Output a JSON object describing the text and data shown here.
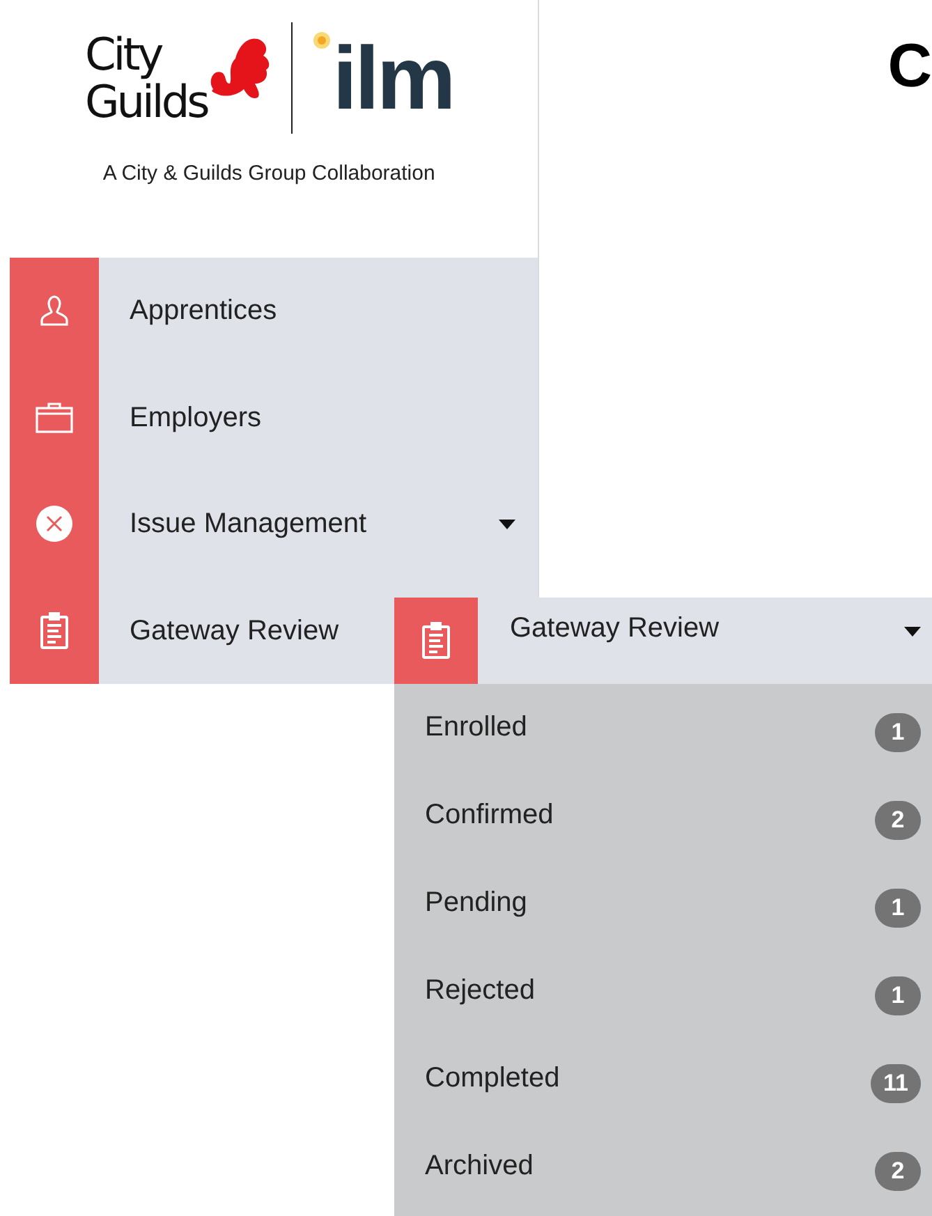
{
  "logo": {
    "wordmark": [
      "City",
      "Guilds"
    ],
    "brand": "ilm",
    "tagline": "A City & Guilds Group Collaboration"
  },
  "heading": "C",
  "sidebar": {
    "items": [
      {
        "label": "Apprentices",
        "kind": "person",
        "has_submenu": false
      },
      {
        "label": "Employers",
        "kind": "briefcase",
        "has_submenu": false
      },
      {
        "label": "Issue Management",
        "kind": "cross",
        "has_submenu": true
      },
      {
        "label": "Gateway Review",
        "kind": "clipboard",
        "has_submenu": false
      }
    ]
  },
  "submenu": {
    "title": "Gateway Review",
    "kind": "clipboard",
    "expanded": true,
    "items": [
      {
        "label": "Enrolled",
        "count": "1"
      },
      {
        "label": "Confirmed",
        "count": "2"
      },
      {
        "label": "Pending",
        "count": "1"
      },
      {
        "label": "Rejected",
        "count": "1"
      },
      {
        "label": "Completed",
        "count": "11"
      },
      {
        "label": "Archived",
        "count": "2"
      }
    ]
  }
}
